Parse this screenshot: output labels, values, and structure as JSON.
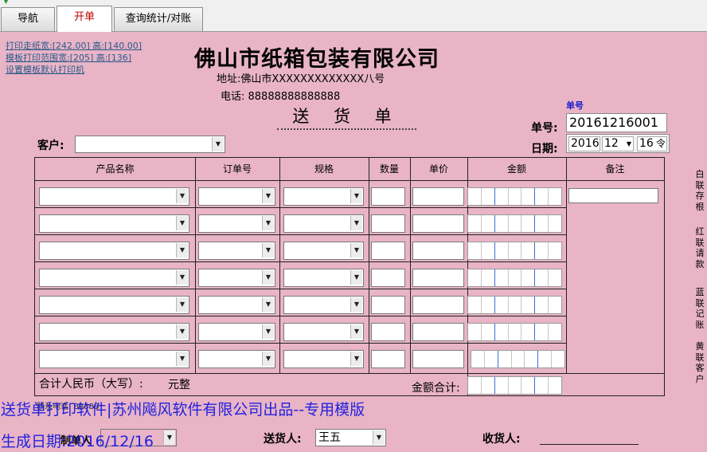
{
  "tabs": [
    {
      "label": "导航"
    },
    {
      "label": "开单"
    },
    {
      "label": "查询统计/对账"
    }
  ],
  "links": [
    "打印走纸宽:[242.00] 高:[140.00]",
    "模板打印范围宽:[205] 高:[136]",
    "设置模板默认打印机"
  ],
  "header": {
    "company": "佛山市纸箱包装有限公司",
    "address": "地址:佛山市XXXXXXXXXXXXX八号",
    "phone": "电话: 88888888888888",
    "title": "送 货 单"
  },
  "customer": {
    "label": "客户:",
    "value": ""
  },
  "order": {
    "small_label": "单号",
    "label": "单号:",
    "value": "20161216001",
    "date_label": "日期:",
    "year": "2016",
    "month": "12",
    "day": "16",
    "day_icon": "令"
  },
  "columns": [
    "产品名称",
    "订单号",
    "规格",
    "数量",
    "单价",
    "金额",
    "备注"
  ],
  "row_count": 7,
  "totals": {
    "cn_label": "合计人民币（大写）:",
    "cn_unit": "元整",
    "sum_label": "金额合计:"
  },
  "side_labels": [
    "白联存根",
    "红联请款",
    "蓝联记账",
    "黄联客户"
  ],
  "footer": {
    "watermark": "送货单打印软件|苏州飚风软件有限公司出品--专用模版",
    "faint_label": "联系电话",
    "faint_value": "88888",
    "gen_label": "生成日期:",
    "gen_date": "2016/12/16",
    "faint2": "制单人",
    "deliver_label": "送货人:",
    "deliver_value": "王五",
    "receiver_label": "收货人:"
  },
  "colors": {
    "form_bg": "#e8b4c6",
    "watermark": "#2222dd",
    "active_tab": "#c00000"
  }
}
